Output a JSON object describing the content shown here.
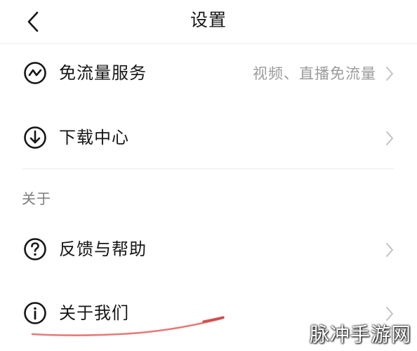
{
  "header": {
    "title": "设置"
  },
  "icons": {
    "back": "chevron-left-icon",
    "data_free": "speedometer-circle-icon",
    "download": "download-circle-icon",
    "feedback": "question-circle-icon",
    "about": "info-circle-icon",
    "chevron": "chevron-right-icon"
  },
  "items": [
    {
      "label": "免流量服务",
      "value": "视频、直播免流量"
    },
    {
      "label": "下载中心"
    },
    {
      "label": "反馈与帮助"
    },
    {
      "label": "关于我们"
    }
  ],
  "section_about": "关于",
  "watermark": "脉冲手游网",
  "colors": {
    "text": "#161616",
    "secondary": "#9b9b9b",
    "chevron": "#c2c2c2",
    "annotation_stroke": "#e26a6a"
  }
}
